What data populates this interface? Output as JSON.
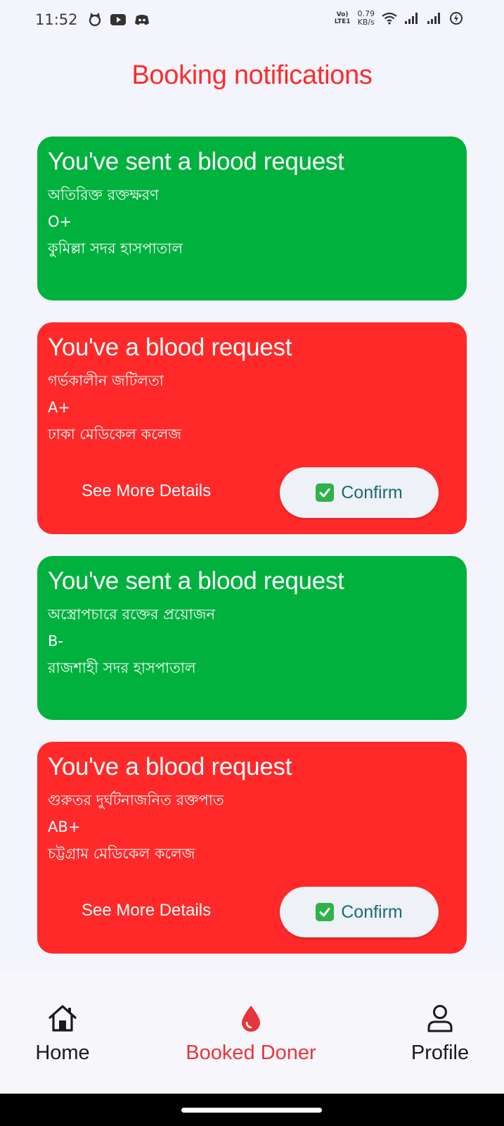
{
  "status_bar": {
    "time": "11:52",
    "volte_top": "Vo)",
    "volte_bottom": "LTE1",
    "speed_value": "0.79",
    "speed_unit": "KB/s",
    "app_icons": [
      "cat-icon",
      "youtube-icon",
      "discord-icon"
    ],
    "system_icons": [
      "wifi-icon",
      "signal-icon",
      "signal-icon",
      "battery-saver-icon"
    ]
  },
  "page": {
    "title": "Booking notifications"
  },
  "colors": {
    "accent": "#ff2b2b",
    "sent_card": "#00b13e",
    "received_card": "#ff2929",
    "confirm_text": "#1b6a78"
  },
  "notifications": [
    {
      "kind": "sent",
      "title": "You've sent a blood request",
      "reason": "অতিরিক্ত রক্তক্ষরণ",
      "blood_group": "O+",
      "hospital": "কুমিল্লা সদর হাসপাতাল"
    },
    {
      "kind": "received",
      "title": "You've a blood request",
      "reason": "গর্ভকালীন জটিলতা",
      "blood_group": "A+",
      "hospital": "ঢাকা মেডিকেল কলেজ",
      "details_label": "See More Details",
      "confirm_label": "Confirm"
    },
    {
      "kind": "sent",
      "title": "You've sent a blood request",
      "reason": "অস্ত্রোপচারে রক্তের প্রয়োজন",
      "blood_group": "B-",
      "hospital": "রাজশাহী সদর হাসপাতাল"
    },
    {
      "kind": "received",
      "title": "You've a blood request",
      "reason": "গুরুতর দুর্ঘটনাজনিত রক্তপাত",
      "blood_group": "AB+",
      "hospital": "চট্টগ্রাম মেডিকেল কলেজ",
      "details_label": "See More Details",
      "confirm_label": "Confirm"
    }
  ],
  "bottom_nav": {
    "items": [
      {
        "label": "Home",
        "icon": "home-icon",
        "active": false
      },
      {
        "label": "Booked Doner",
        "icon": "blood-drop-icon",
        "active": true
      },
      {
        "label": "Profile",
        "icon": "profile-icon",
        "active": false
      }
    ]
  }
}
